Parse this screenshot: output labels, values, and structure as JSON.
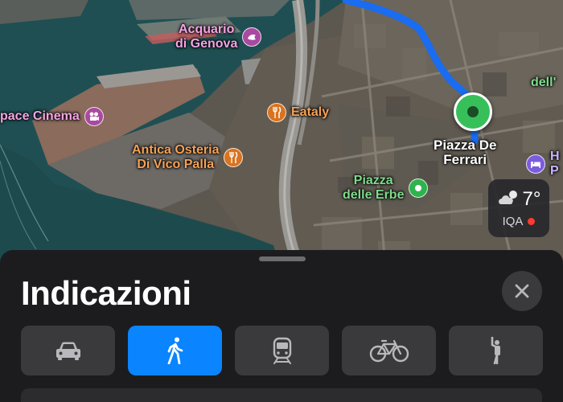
{
  "map": {
    "pois": [
      {
        "id": "acquario",
        "label": "Acquario\ndi Genova",
        "kind": "aquarium-icon"
      },
      {
        "id": "space-cinema",
        "label": "pace Cinema",
        "kind": "cinema-icon"
      },
      {
        "id": "eataly",
        "label": "Eataly",
        "kind": "fork-knife-icon"
      },
      {
        "id": "antica-osteria",
        "label": "Antica Osteria\nDi Vico Palla",
        "kind": "fork-knife-icon"
      },
      {
        "id": "piazza-erbe",
        "label": "Piazza\ndelle Erbe",
        "kind": "tree-icon"
      },
      {
        "id": "hotel",
        "label": "H\nP",
        "kind": "bed-icon"
      },
      {
        "id": "partial-dell",
        "label": "dell'"
      }
    ],
    "destination": {
      "label": "Piazza De\nFerrari"
    },
    "weather": {
      "temperature": "7°",
      "iqa_label": "IQA",
      "condition": "partly-cloudy-icon",
      "iqa_color": "#ff3b30"
    }
  },
  "sheet": {
    "title": "Indicazioni",
    "close_label": "close",
    "modes": [
      {
        "name": "car",
        "icon": "car-icon",
        "active": false
      },
      {
        "name": "walk",
        "icon": "walk-icon",
        "active": true
      },
      {
        "name": "transit",
        "icon": "train-icon",
        "active": false
      },
      {
        "name": "bike",
        "icon": "bicycle-icon",
        "active": false
      },
      {
        "name": "rideshare",
        "icon": "hail-icon",
        "active": false
      }
    ]
  },
  "colors": {
    "accent": "#0a84ff",
    "route": "#1a6cf0",
    "pin": "#37c05a",
    "sheet": "#1c1c1e"
  }
}
